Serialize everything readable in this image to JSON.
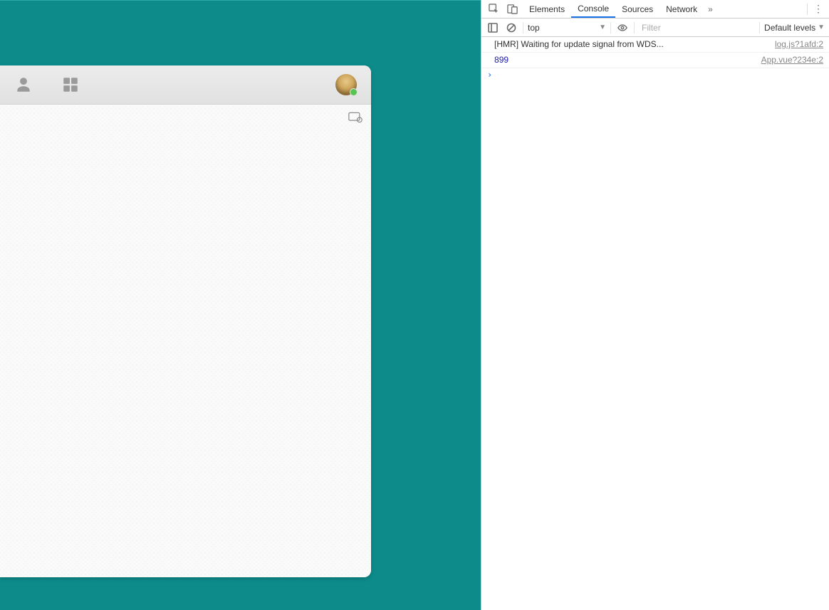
{
  "appHeader": {
    "personIcon": "person",
    "gridIcon": "grid",
    "avatar": "user-avatar",
    "presence": "online"
  },
  "devtools": {
    "tabs": [
      "Elements",
      "Console",
      "Sources",
      "Network"
    ],
    "activeTab": "Console",
    "toolbar": {
      "context": "top",
      "filterPlaceholder": "Filter",
      "levels": "Default levels"
    },
    "logs": [
      {
        "msg": "[HMR] Waiting for update signal from WDS...",
        "src": "log.js?1afd:2",
        "cls": ""
      },
      {
        "msg": "899",
        "src": "App.vue?234e:2",
        "cls": "number"
      }
    ],
    "prompt": "›"
  }
}
